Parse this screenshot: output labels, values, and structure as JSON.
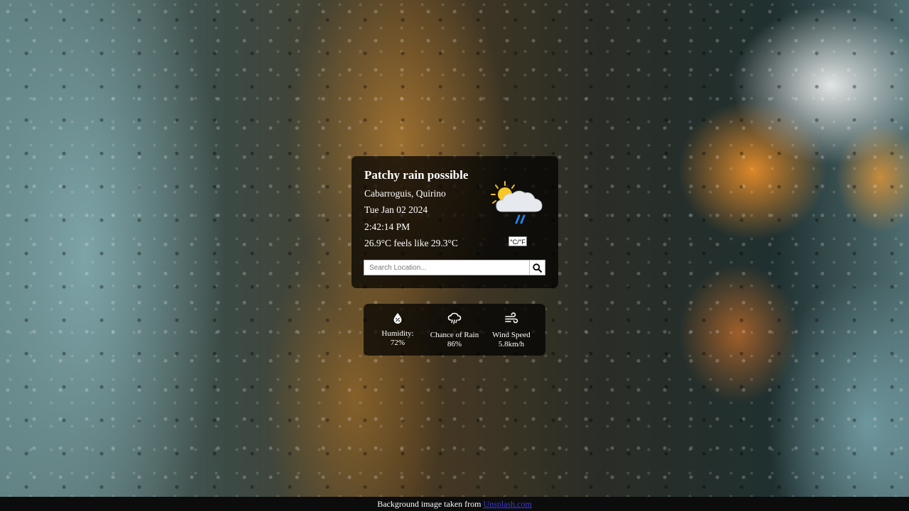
{
  "weather": {
    "condition": "Patchy rain possible",
    "location": "Cabarroguis, Quirino",
    "date": "Tue Jan 02 2024",
    "time": "2:42:14 PM",
    "temperature": "26.9°C feels like 29.3°C",
    "icon": "sun-cloud-rain-icon",
    "unit_toggle_label": "°C/°F"
  },
  "search": {
    "placeholder": "Search Location...",
    "value": ""
  },
  "stats": {
    "humidity": {
      "label": "Humidity:",
      "value": "72%",
      "icon": "humidity-drop-icon"
    },
    "rain": {
      "label": "Chance of Rain",
      "value": "86%",
      "icon": "rain-cloud-icon"
    },
    "wind": {
      "label": "Wind Speed",
      "value": "5.8km/h",
      "icon": "wind-icon"
    }
  },
  "footer": {
    "text": "Background image taken from",
    "link": "Unsplash.com"
  },
  "colors": {
    "card_bg": "#000000b8",
    "link": "#3b3bd6",
    "text": "#ffffff"
  }
}
